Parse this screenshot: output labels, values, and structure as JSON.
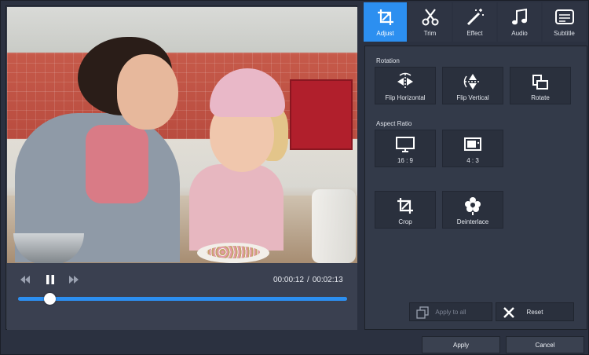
{
  "player": {
    "current_time": "00:00:12",
    "separator": "/",
    "total_time": "00:02:13",
    "progress_fraction": 0.095
  },
  "tabs": [
    {
      "label": "Adjust",
      "icon": "crop-adjust-icon",
      "active": true
    },
    {
      "label": "Trim",
      "icon": "scissors-icon",
      "active": false
    },
    {
      "label": "Effect",
      "icon": "magic-wand-icon",
      "active": false
    },
    {
      "label": "Audio",
      "icon": "music-note-icon",
      "active": false
    },
    {
      "label": "Subtitle",
      "icon": "subtitle-icon",
      "active": false
    }
  ],
  "rotation": {
    "title": "Rotation",
    "flip_horizontal": "Flip Horizontal",
    "flip_vertical": "Flip Vertical",
    "rotate": "Rotate"
  },
  "aspect_ratio": {
    "title": "Aspect Ratio",
    "ratio_16_9": "16 : 9",
    "ratio_4_3": "4 : 3"
  },
  "tools": {
    "crop": "Crop",
    "deinterlace": "Deinterlace"
  },
  "panel_footer": {
    "apply_to_all": "Apply to all",
    "reset": "Reset"
  },
  "dialog": {
    "apply": "Apply",
    "cancel": "Cancel"
  },
  "colors": {
    "accent": "#2c8ff0",
    "background": "#2b3140",
    "panel": "#333a49"
  }
}
